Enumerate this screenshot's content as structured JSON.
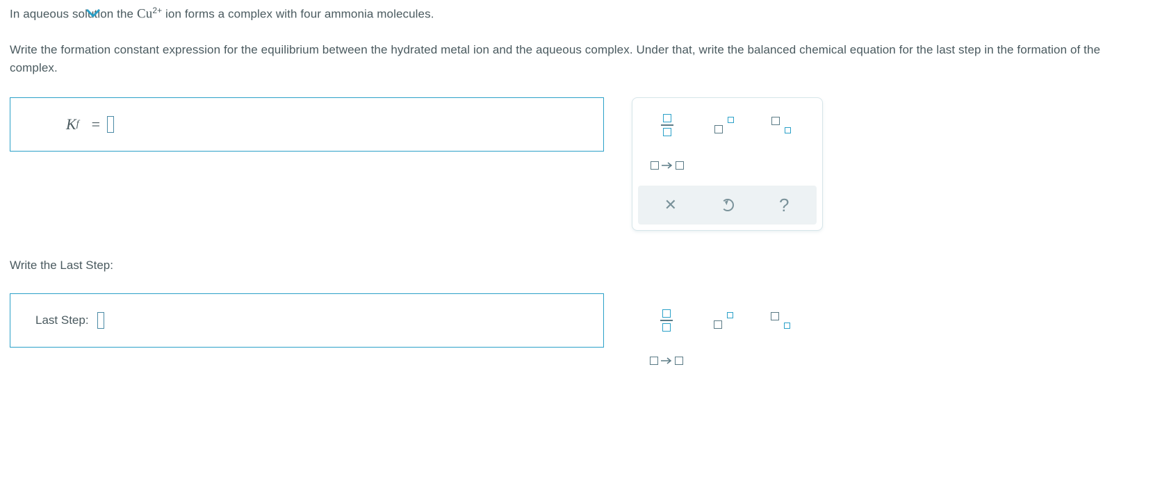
{
  "question": {
    "line1_a": "In aqueous solution the ",
    "line1_chem": "Cu",
    "line1_sup": "2+",
    "line1_b": " ion forms a complex with four ammonia molecules.",
    "line2": "Write the formation constant expression for the equilibrium between the hydrated metal ion and the aqueous complex. Under that, write the balanced chemical equation for the last step in the formation of the complex."
  },
  "inputs": {
    "kf_symbol": "K",
    "kf_subscript": "f",
    "kf_equals": "=",
    "section_label": "Write the Last Step:",
    "last_step_label": "Last Step:"
  },
  "tools": {
    "fraction": "fraction",
    "superscript": "superscript",
    "subscript": "subscript",
    "arrow": "reaction-arrow",
    "clear": "clear",
    "reset": "reset",
    "help": "help"
  }
}
